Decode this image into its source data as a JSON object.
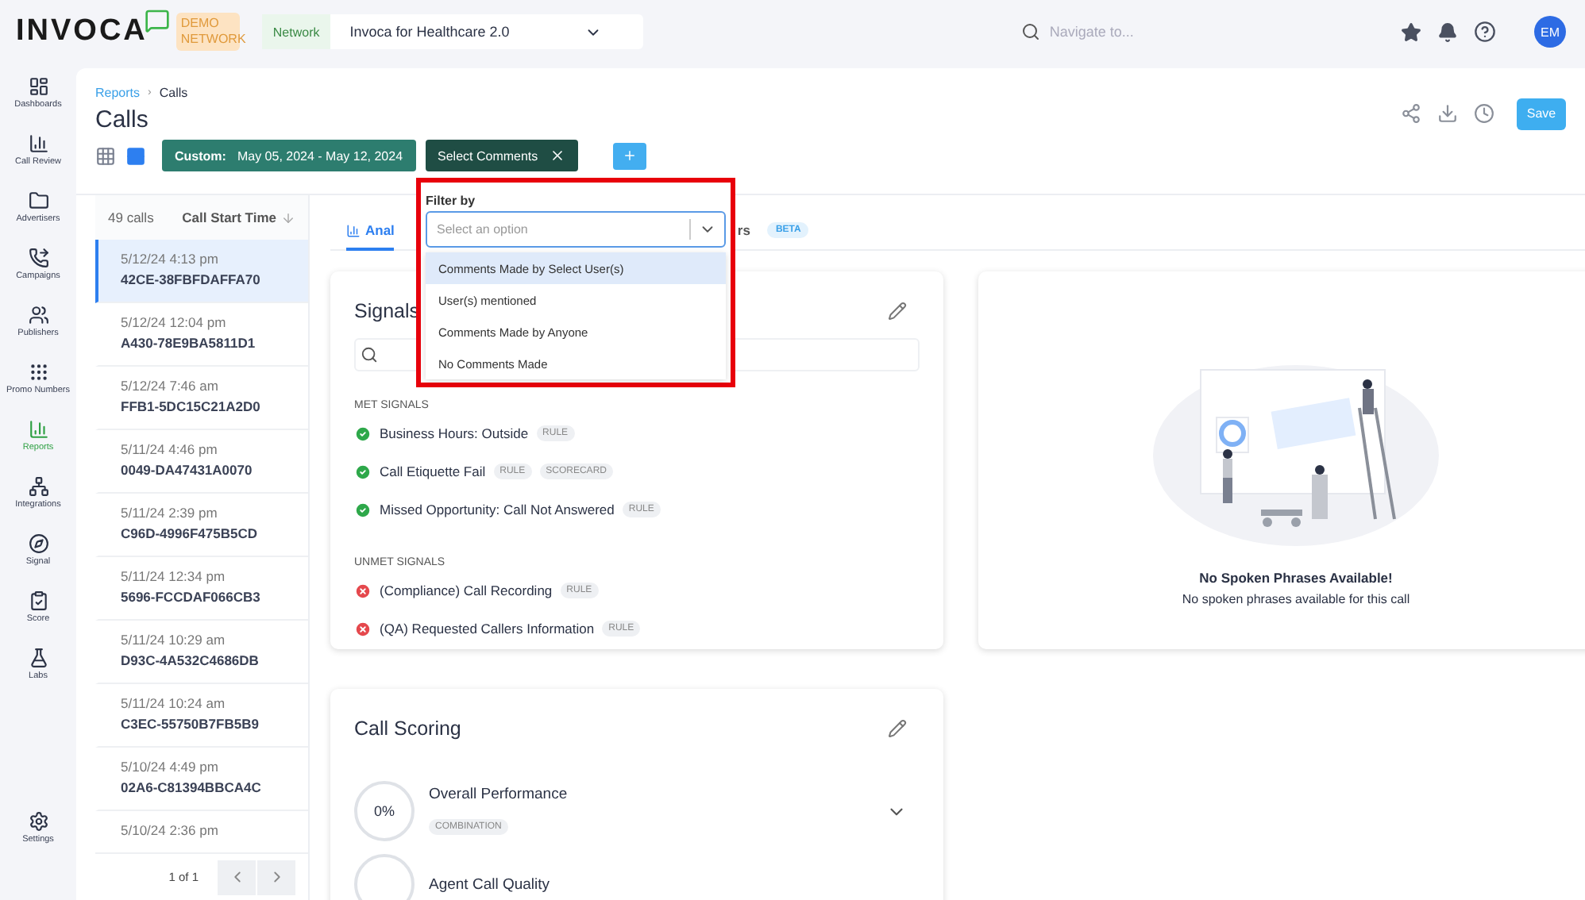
{
  "header": {
    "logo": "INVOCA",
    "demo_badge": "DEMO NETWORK",
    "network_label": "Network",
    "network_value": "Invoca for Healthcare 2.0",
    "search_placeholder": "Navigate to...",
    "avatar": "EM"
  },
  "nav": [
    {
      "label": "Dashboards",
      "selected": false
    },
    {
      "label": "Call Review",
      "selected": false
    },
    {
      "label": "Advertisers",
      "selected": false
    },
    {
      "label": "Campaigns",
      "selected": false
    },
    {
      "label": "Publishers",
      "selected": false
    },
    {
      "label": "Promo Numbers",
      "selected": false
    },
    {
      "label": "Reports",
      "selected": true
    },
    {
      "label": "Integrations",
      "selected": false
    },
    {
      "label": "Signal",
      "selected": false
    },
    {
      "label": "Score",
      "selected": false
    },
    {
      "label": "Labs",
      "selected": false
    }
  ],
  "nav_footer": {
    "label": "Settings"
  },
  "breadcrumb": {
    "parent": "Reports",
    "separator": "›",
    "current": "Calls"
  },
  "page_title": "Calls",
  "view_toggle": [
    {
      "selected": false
    },
    {
      "selected": true
    }
  ],
  "filters": [
    {
      "kind": "date",
      "label": "Custom:",
      "value": "May 05, 2024 - May 12, 2024"
    },
    {
      "kind": "chip",
      "label": "Select Comments"
    }
  ],
  "save_label": "Save",
  "call_list": {
    "count": "49 calls",
    "sort_label": "Call Start Time",
    "pagination": "1 of 1",
    "rows": [
      {
        "time": "5/12/24 4:13 pm",
        "id": "42CE-38FBFDAFFA70",
        "selected": true
      },
      {
        "time": "5/12/24 12:04 pm",
        "id": "A430-78E9BA5811D1",
        "selected": false
      },
      {
        "time": "5/12/24 7:46 am",
        "id": "FFB1-5DC15C21A2D0",
        "selected": false
      },
      {
        "time": "5/11/24 4:46 pm",
        "id": "0049-DA47431A0070",
        "selected": false
      },
      {
        "time": "5/11/24 2:39 pm",
        "id": "C96D-4996F475B5CD",
        "selected": false
      },
      {
        "time": "5/11/24 12:34 pm",
        "id": "5696-FCCDAF066CB3",
        "selected": false
      },
      {
        "time": "5/11/24 10:29 am",
        "id": "D93C-4A532C4686DB",
        "selected": false
      },
      {
        "time": "5/11/24 10:24 am",
        "id": "C3EC-55750B7FB5B9",
        "selected": false
      },
      {
        "time": "5/10/24 4:49 pm",
        "id": "02A6-C81394BBCA4C",
        "selected": false
      },
      {
        "time": "5/10/24 2:36 pm",
        "selected": false
      }
    ]
  },
  "tabs": [
    {
      "label": "Anal",
      "selected": true
    },
    {
      "label": "rs",
      "selected": false,
      "badge": "BETA"
    }
  ],
  "signals": {
    "title": "Signals",
    "groups": [
      {
        "heading": "MET SIGNALS",
        "items": [
          {
            "name": "Business Hours: Outside",
            "met": true,
            "tags": [
              "RULE"
            ]
          },
          {
            "name": "Call Etiquette Fail",
            "met": true,
            "tags": [
              "RULE",
              "SCORECARD"
            ]
          },
          {
            "name": "Missed Opportunity: Call Not Answered",
            "met": true,
            "tags": [
              "RULE"
            ]
          }
        ]
      },
      {
        "heading": "UNMET SIGNALS",
        "items": [
          {
            "name": "(Compliance) Call Recording",
            "met": false,
            "tags": [
              "RULE"
            ]
          },
          {
            "name": "(QA) Requested Callers Information",
            "met": false,
            "tags": [
              "RULE"
            ]
          }
        ]
      }
    ]
  },
  "spoken_phrases": {
    "title": "No Spoken Phrases Available!",
    "message": "No spoken phrases available for this call"
  },
  "scoring": {
    "title": "Call Scoring",
    "items": [
      {
        "score": "0%",
        "name": "Overall Performance",
        "tag": "COMBINATION",
        "expanded": false
      },
      {
        "name": "Agent Call Quality"
      }
    ]
  },
  "filter_dropdown": {
    "label": "Filter by",
    "placeholder": "Select an option",
    "options": [
      {
        "label": "Comments Made by Select User(s)",
        "selected": true
      },
      {
        "label": "User(s) mentioned",
        "selected": false
      },
      {
        "label": "Comments Made by Anyone",
        "selected": false
      },
      {
        "label": "No Comments Made",
        "selected": false
      }
    ]
  }
}
